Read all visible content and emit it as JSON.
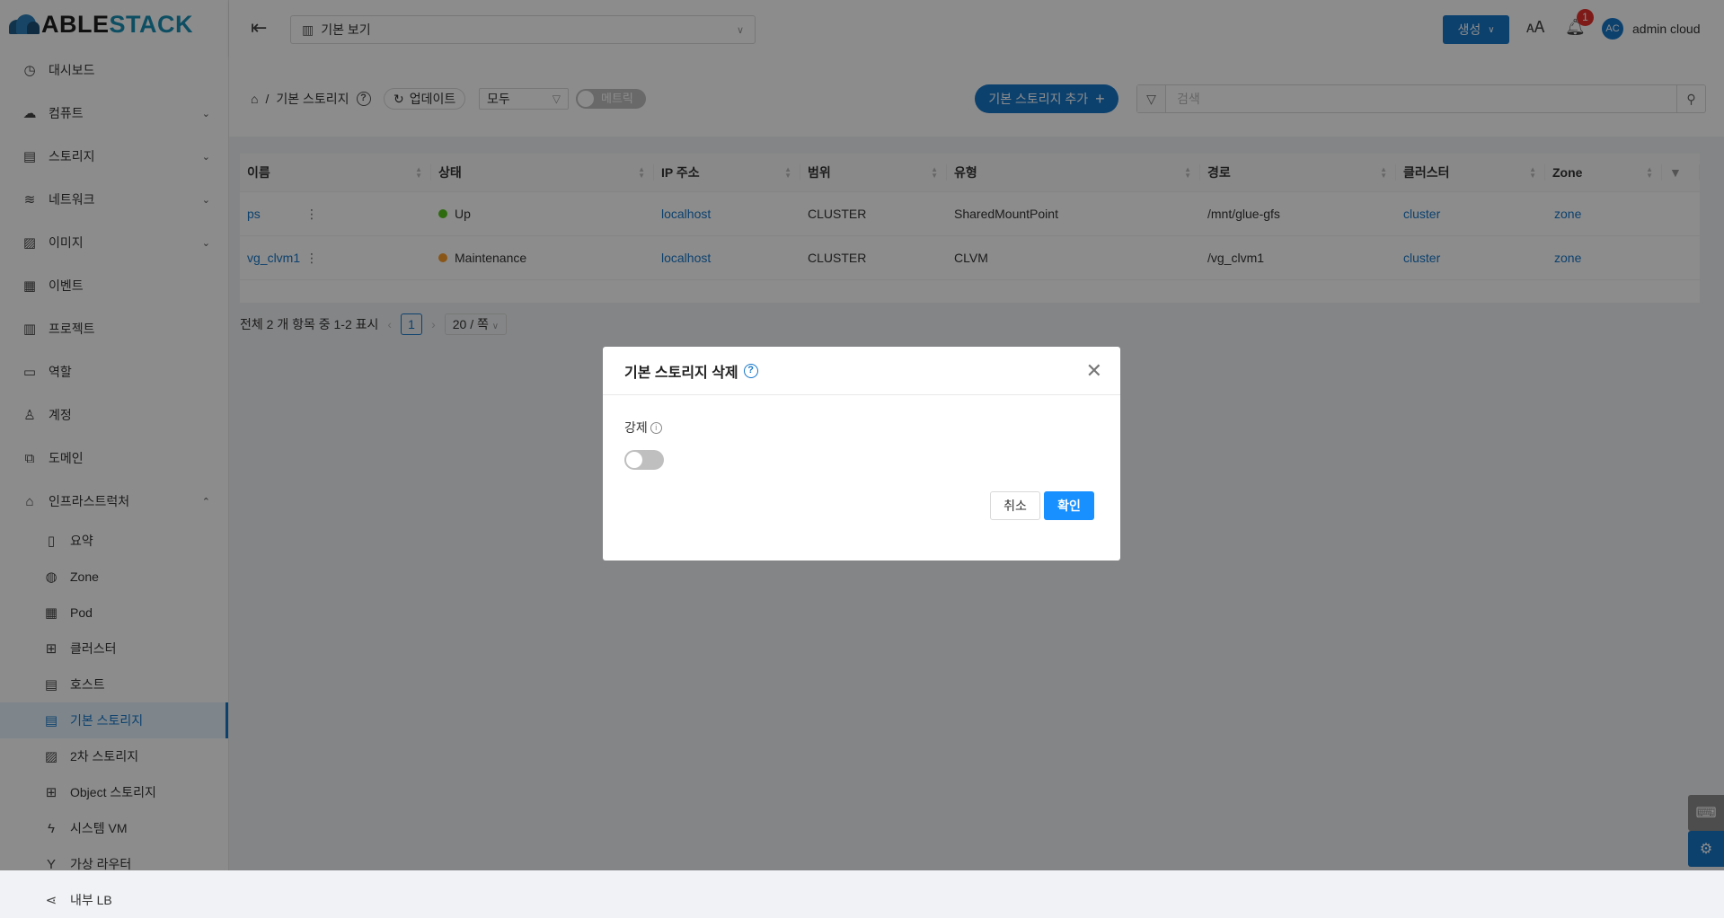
{
  "logo": {
    "part1": "ABLE",
    "part2": "STACK"
  },
  "sidebar": {
    "items": [
      {
        "label": "대시보드",
        "icon": "◷",
        "chevron": ""
      },
      {
        "label": "컴퓨트",
        "icon": "☁",
        "chevron": "⌄"
      },
      {
        "label": "스토리지",
        "icon": "▤",
        "chevron": "⌄"
      },
      {
        "label": "네트워크",
        "icon": "≋",
        "chevron": "⌄"
      },
      {
        "label": "이미지",
        "icon": "▨",
        "chevron": "⌄"
      },
      {
        "label": "이벤트",
        "icon": "▦",
        "chevron": ""
      },
      {
        "label": "프로젝트",
        "icon": "▥",
        "chevron": ""
      },
      {
        "label": "역할",
        "icon": "▭",
        "chevron": ""
      },
      {
        "label": "계정",
        "icon": "♙",
        "chevron": ""
      },
      {
        "label": "도메인",
        "icon": "⧉",
        "chevron": ""
      },
      {
        "label": "인프라스트럭처",
        "icon": "⌂",
        "chevron": "⌃"
      }
    ],
    "sub_items": [
      {
        "label": "요약",
        "icon": "▯"
      },
      {
        "label": "Zone",
        "icon": "◍"
      },
      {
        "label": "Pod",
        "icon": "▦"
      },
      {
        "label": "클러스터",
        "icon": "⊞"
      },
      {
        "label": "호스트",
        "icon": "▤"
      },
      {
        "label": "기본 스토리지",
        "icon": "▤"
      },
      {
        "label": "2차 스토리지",
        "icon": "▨"
      },
      {
        "label": "Object 스토리지",
        "icon": "⊞"
      },
      {
        "label": "시스템 VM",
        "icon": "ϟ"
      },
      {
        "label": "가상 라우터",
        "icon": "Y"
      },
      {
        "label": "내부 LB",
        "icon": "⋖"
      }
    ]
  },
  "header": {
    "view_select": "기본 보기",
    "create_label": "생성",
    "notification_count": "1",
    "avatar_initials": "AC",
    "username": "admin cloud"
  },
  "toolbar": {
    "breadcrumb_page": "기본 스토리지",
    "refresh_label": "업데이트",
    "filter_value": "모두",
    "metrics_label": "메트릭",
    "add_label": "기본 스토리지 추가",
    "search_placeholder": "검색"
  },
  "table": {
    "columns": [
      "이름",
      "상태",
      "IP 주소",
      "범위",
      "유형",
      "경로",
      "클러스터",
      "Zone"
    ],
    "rows": [
      {
        "name": "ps",
        "state": "Up",
        "state_color": "#52c41a",
        "ip": "localhost",
        "scope": "CLUSTER",
        "type": "SharedMountPoint",
        "path": "/mnt/glue-gfs",
        "cluster": "cluster",
        "zone": "zone"
      },
      {
        "name": "vg_clvm1",
        "state": "Maintenance",
        "state_color": "#fa9d2c",
        "ip": "localhost",
        "scope": "CLUSTER",
        "type": "CLVM",
        "path": "/vg_clvm1",
        "cluster": "cluster",
        "zone": "zone"
      }
    ]
  },
  "pagination": {
    "summary": "전체 2 개 항목 중 1-2 표시",
    "current_page": "1",
    "page_size": "20 / 쪽"
  },
  "modal": {
    "title": "기본 스토리지 삭제",
    "force_label": "강제",
    "force_enabled": false,
    "cancel_label": "취소",
    "ok_label": "확인"
  }
}
